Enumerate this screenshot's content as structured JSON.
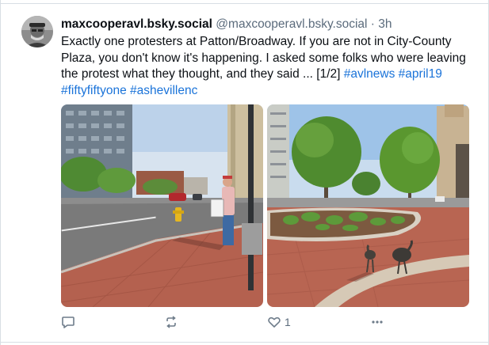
{
  "post": {
    "display_name": "maxcooperavl.bsky.social",
    "handle": "@maxcooperavl.bsky.social",
    "separator": " · ",
    "timestamp": "3h",
    "text": "Exactly one protesters at Patton/Broadway. If you are not in City-County Plaza, you don't know it's happening. I asked some folks who were leaving the protest what they thought, and they said ... [1/2]",
    "hashtags": [
      "#avlnews",
      "#april19",
      "#fiftyfiftyone",
      "#ashevillenc"
    ]
  },
  "actions": {
    "reply_icon": "speech-bubble-icon",
    "repost_icon": "repost-arrows-icon",
    "like_icon": "heart-icon",
    "like_count": "1",
    "more_icon": "more-dots-icon"
  },
  "images": {
    "left_alt": "Street corner photo with a lone protester holding a sign",
    "right_alt": "Plaza with trees and bronze turkey statues"
  },
  "colors": {
    "link": "#1a73d9",
    "muted": "#5b6b7c",
    "icon": "#6e7c8a"
  }
}
